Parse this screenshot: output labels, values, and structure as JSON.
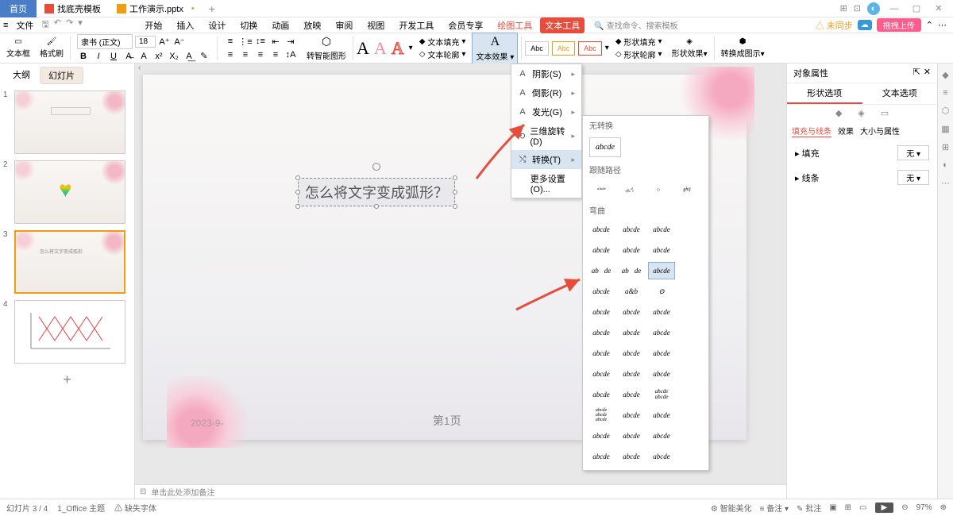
{
  "titlebar": {
    "home": "首页",
    "tab1": "找底壳模板",
    "tab2": "工作演示.pptx"
  },
  "menu": {
    "file_btn": "≡",
    "file": "文件",
    "items": [
      "开始",
      "插入",
      "设计",
      "切换",
      "动画",
      "放映",
      "审阅",
      "视图",
      "开发工具",
      "会员专享"
    ],
    "highlight": "绘图工具",
    "pill": "文本工具",
    "search": "查找命令、搜索模板",
    "unsync": "未同步",
    "upload": "拖拽上传"
  },
  "ribbon": {
    "group1a": "文本框",
    "group1b": "格式刷",
    "font": "隶书 (正文)",
    "size": "18",
    "text_fill": "文本填充",
    "text_outline": "文本轮廓",
    "text_effect": "文本效果",
    "shape_fill": "形状填充",
    "shape_outline": "形状轮廓",
    "shape_effect": "形状效果",
    "convert_smart": "转智能图形",
    "convert_diagram": "转换成图示",
    "abc": "Abc"
  },
  "effect_menu": {
    "shadow": "阴影(S)",
    "reflection": "倒影(R)",
    "glow": "发光(G)",
    "rotation3d": "三维旋转(D)",
    "transform": "转换(T)",
    "more": "更多设置(O)..."
  },
  "transform": {
    "none_header": "无转换",
    "none_sample": "abcde",
    "path_header": "跟随路径",
    "warp_header": "弯曲",
    "warp_sample": "abcde"
  },
  "outline": {
    "tab1": "大纲",
    "tab2": "幻灯片"
  },
  "slide": {
    "text": "怎么将文字变成弧形？",
    "date": "2023-9-",
    "page": "第1页"
  },
  "notes": {
    "placeholder": "单击此处添加备注"
  },
  "right_panel": {
    "title": "对象属性",
    "tab1": "形状选项",
    "tab2": "文本选项",
    "sub1": "填充与线条",
    "sub2": "效果",
    "sub3": "大小与属性",
    "fill": "填充",
    "line": "线条",
    "none": "无"
  },
  "status": {
    "slide_info": "幻灯片 3 / 4",
    "theme": "1_Office 主题",
    "missing_font": "缺失字体",
    "beautify": "智能美化",
    "notes": "备注",
    "comments": "批注",
    "zoom": "97%"
  }
}
